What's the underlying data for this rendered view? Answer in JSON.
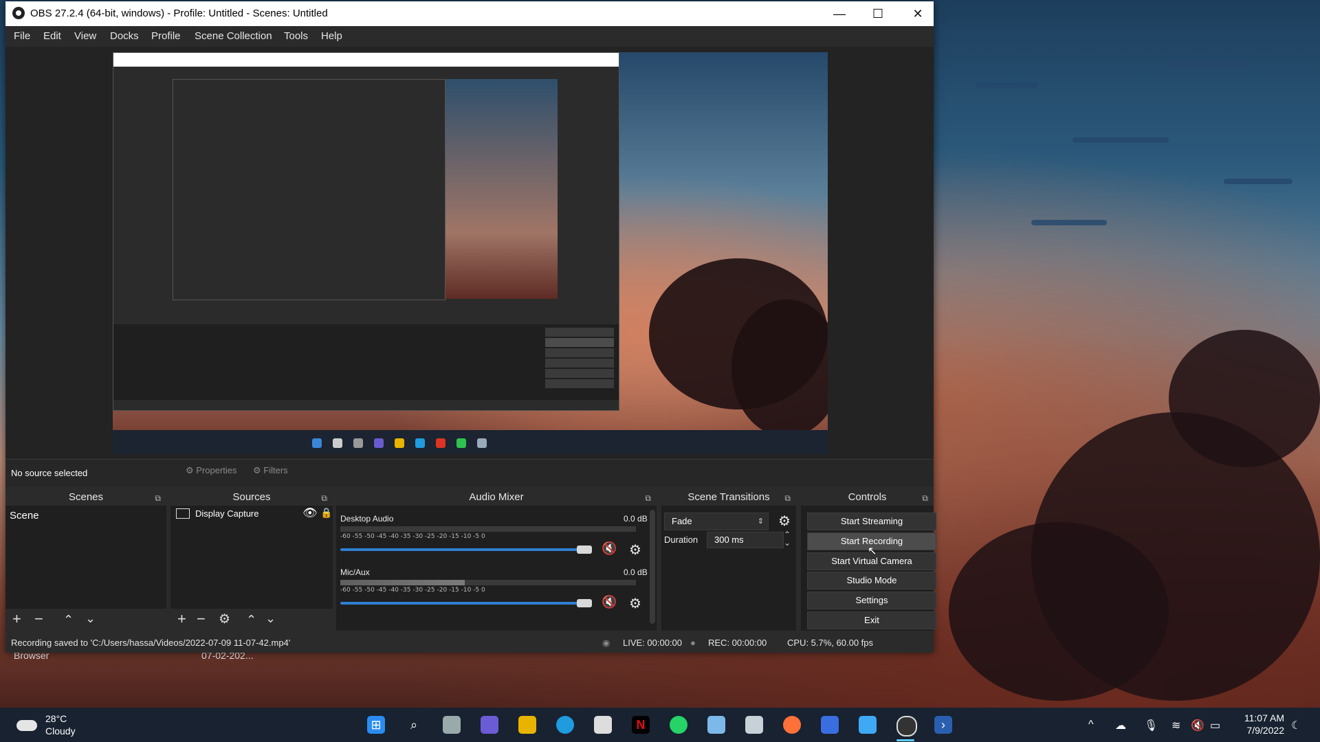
{
  "window": {
    "title": "OBS 27.2.4 (64-bit, windows) - Profile: Untitled - Scenes: Untitled",
    "minimize": "—",
    "maximize": "☐",
    "close": "✕"
  },
  "menu": [
    "File",
    "Edit",
    "View",
    "Docks",
    "Profile",
    "Scene Collection",
    "Tools",
    "Help"
  ],
  "source_bar": {
    "no_source": "No source selected",
    "properties": "Properties",
    "filters": "Filters"
  },
  "docks": {
    "scenes": {
      "title": "Scenes",
      "items": [
        "Scene"
      ]
    },
    "sources": {
      "title": "Sources",
      "items": [
        {
          "label": "Display Capture",
          "icon": "monitor-icon"
        }
      ]
    },
    "audio_mixer": {
      "title": "Audio Mixer",
      "channels": [
        {
          "name": "Desktop Audio",
          "db": "0.0 dB",
          "level": 0.0,
          "volume": 0.95
        },
        {
          "name": "Mic/Aux",
          "db": "0.0 dB",
          "level": 0.42,
          "volume": 0.95
        }
      ],
      "ticks": "-60  -55  -50  -45  -40  -35  -30  -25  -20  -15  -10  -5  0"
    },
    "scene_transitions": {
      "title": "Scene Transitions",
      "transition": "Fade",
      "duration_label": "Duration",
      "duration_value": "300 ms"
    },
    "controls": {
      "title": "Controls",
      "buttons": [
        "Start Streaming",
        "Start Recording",
        "Start Virtual Camera",
        "Studio Mode",
        "Settings",
        "Exit"
      ]
    }
  },
  "status": {
    "message": "Recording saved to 'C:/Users/hassa/Videos/2022-07-09 11-07-42.mp4'",
    "live": "LIVE: 00:00:00",
    "rec": "REC: 00:00:00",
    "cpu": "CPU: 5.7%, 60.00 fps"
  },
  "desktop": {
    "label1": "Browser",
    "label2": "07-02-202..."
  },
  "taskbar": {
    "temp": "28°C",
    "condition": "Cloudy",
    "time": "11:07 AM",
    "date": "7/9/2022",
    "apps": [
      "start-icon",
      "search-icon",
      "task-view-icon",
      "chat-icon",
      "file-explorer-icon",
      "edge-icon",
      "store-icon",
      "netflix-icon",
      "whatsapp-icon",
      "photos-icon",
      "snipping-icon",
      "firefox-icon",
      "remote-icon",
      "notepad-icon",
      "obs-icon",
      "powershell-icon"
    ]
  },
  "colors": {
    "accent": "#2f7fd1",
    "mute": "#d62626",
    "panel": "#2b2b2b"
  }
}
